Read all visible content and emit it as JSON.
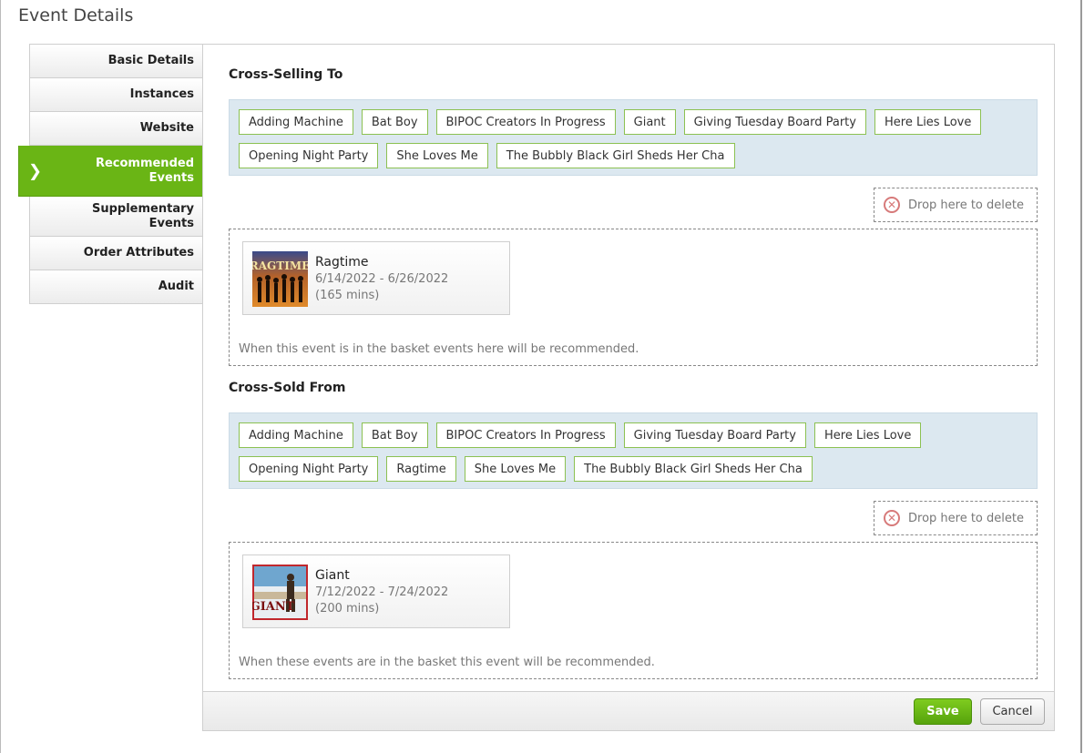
{
  "page": {
    "title": "Event Details"
  },
  "sidebar": {
    "items": [
      {
        "label": "Basic Details"
      },
      {
        "label": "Instances"
      },
      {
        "label": "Website"
      },
      {
        "label": "Recommended Events",
        "line1": "Recommended",
        "line2": "Events"
      },
      {
        "label": "Supplementary Events",
        "line1": "Supplementary",
        "line2": "Events"
      },
      {
        "label": "Order Attributes"
      },
      {
        "label": "Audit"
      }
    ]
  },
  "cross_selling_to": {
    "title": "Cross-Selling To",
    "tags_row1": [
      "Adding Machine",
      "Bat Boy",
      "BIPOC Creators In Progress",
      "Giant",
      "Giving Tuesday Board Party",
      "Here Lies Love"
    ],
    "tags_row2": [
      "Opening Night Party",
      "She Loves Me",
      "The Bubbly Black Girl Sheds Her Cha"
    ],
    "drop_delete": "Drop here to delete",
    "event": {
      "name": "Ragtime",
      "dates": "6/14/2022 - 6/26/2022",
      "duration": "(165 mins)"
    },
    "note": "When this event is in the basket events here will be recommended."
  },
  "cross_sold_from": {
    "title": "Cross-Sold From",
    "tags_row1": [
      "Adding Machine",
      "Bat Boy",
      "BIPOC Creators In Progress",
      "Giving Tuesday Board Party",
      "Here Lies Love"
    ],
    "tags_row2": [
      "Opening Night Party",
      "Ragtime",
      "She Loves Me",
      "The Bubbly Black Girl Sheds Her Cha"
    ],
    "drop_delete": "Drop here to delete",
    "event": {
      "name": "Giant",
      "dates": "7/12/2022 - 7/24/2022",
      "duration": "(200 mins)"
    },
    "note": "When these events are in the basket this event will be recommended."
  },
  "footer": {
    "save_label": "Save",
    "cancel_label": "Cancel"
  },
  "colors": {
    "accent": "#6ab515",
    "tag_border": "#8cc152",
    "tag_area_bg": "#dce8f0"
  }
}
